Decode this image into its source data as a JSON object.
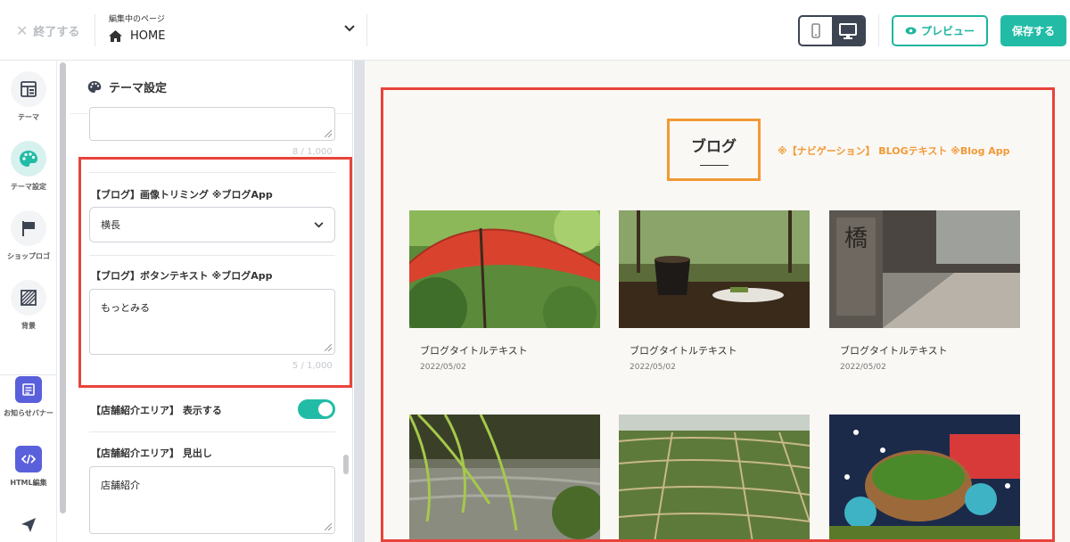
{
  "header": {
    "exit_label": "終了する",
    "page_caption": "編集中のページ",
    "page_value": "HOME",
    "preview_label": "プレビュー",
    "save_label": "保存する",
    "accent_color": "#22bca6"
  },
  "rail": {
    "items": [
      {
        "label": "テーマ",
        "icon": "layout-icon"
      },
      {
        "label": "テーマ設定",
        "icon": "palette-icon",
        "active": true
      },
      {
        "label": "ショップロゴ",
        "icon": "flag-icon"
      },
      {
        "label": "背景",
        "icon": "pattern-icon"
      },
      {
        "label": "お知らせバナー",
        "icon": "banner-icon"
      },
      {
        "label": "HTML編集",
        "icon": "code-icon"
      }
    ]
  },
  "panel": {
    "title": "テーマ設定",
    "top_counter": "8 / 1,000",
    "blog_trim_label": "【ブログ】画像トリミング ※ブログApp",
    "blog_trim_value": "横長",
    "blog_button_label": "【ブログ】ボタンテキスト ※ブログApp",
    "blog_button_value": "もっとみる",
    "blog_button_counter": "5 / 1,000",
    "store_area_label": "【店舗紹介エリア】 表示する",
    "store_area_toggle": true,
    "store_heading_label": "【店舗紹介エリア】 見出し",
    "store_heading_value": "店舗紹介"
  },
  "preview": {
    "blog_heading": "ブログ",
    "nav_note": "※【ナビゲーション】 BLOGテキスト ※Blog App",
    "cards": [
      {
        "title": "ブログタイトルテキスト",
        "date": "2022/05/02"
      },
      {
        "title": "ブログタイトルテキスト",
        "date": "2022/05/02"
      },
      {
        "title": "ブログタイトルテキスト",
        "date": "2022/05/02"
      }
    ]
  }
}
